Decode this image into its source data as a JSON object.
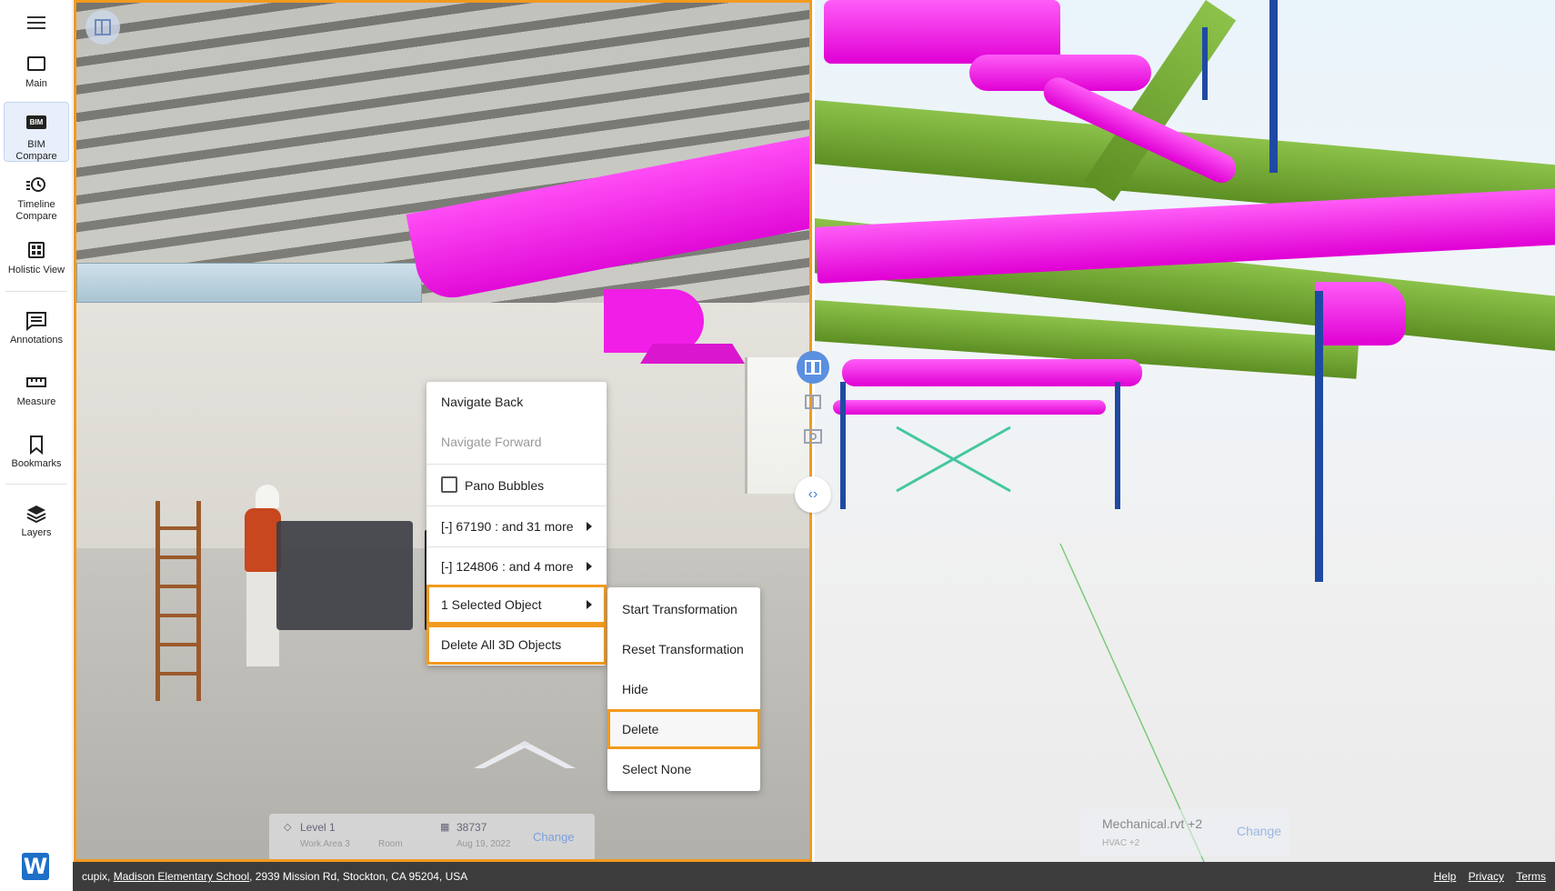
{
  "sidebar": {
    "items": [
      {
        "label": "Main",
        "icon": "monitor-icon"
      },
      {
        "label": "BIM Compare",
        "icon": "bim-icon",
        "icon_text": "BIM"
      },
      {
        "label": "Timeline Compare",
        "icon": "timeline-icon"
      },
      {
        "label": "Holistic View",
        "icon": "grid-icon"
      },
      {
        "label": "Annotations",
        "icon": "annotation-icon"
      },
      {
        "label": "Measure",
        "icon": "ruler-icon"
      },
      {
        "label": "Bookmarks",
        "icon": "bookmark-icon"
      },
      {
        "label": "Layers",
        "icon": "layers-icon"
      }
    ],
    "logo_letter": "W"
  },
  "pano": {
    "level_label": "Level 1",
    "work_area": "Work Area 3",
    "room": "Room",
    "capture_id": "38737",
    "capture_date": "Aug 19, 2022",
    "change_label": "Change"
  },
  "bim": {
    "model_name": "Mechanical.rvt +2",
    "model_sub": "HVAC +2",
    "change_label": "Change"
  },
  "context_menu": {
    "navigate_back": "Navigate Back",
    "navigate_forward": "Navigate Forward",
    "pano_bubbles": "Pano Bubbles",
    "group1": "[-] 67190 : and 31 more",
    "group2": "[-] 124806 : and 4 more",
    "selected": "1 Selected Object",
    "delete_all": "Delete All 3D Objects"
  },
  "submenu": {
    "start": "Start Transformation",
    "reset": "Reset Transformation",
    "hide": "Hide",
    "delete": "Delete",
    "select_none": "Select None"
  },
  "footer": {
    "company": "cupix,",
    "project": "Madison Elementary School",
    "address": ", 2939 Mission Rd, Stockton, CA 95204, USA",
    "help": "Help",
    "privacy": "Privacy",
    "terms": "Terms"
  },
  "colors": {
    "accent_orange": "#f29a1f",
    "duct_magenta": "#f01ee6",
    "steel_green": "#6fa632",
    "column_blue": "#1f4aa3",
    "footer_bg": "#3c3c3c"
  }
}
